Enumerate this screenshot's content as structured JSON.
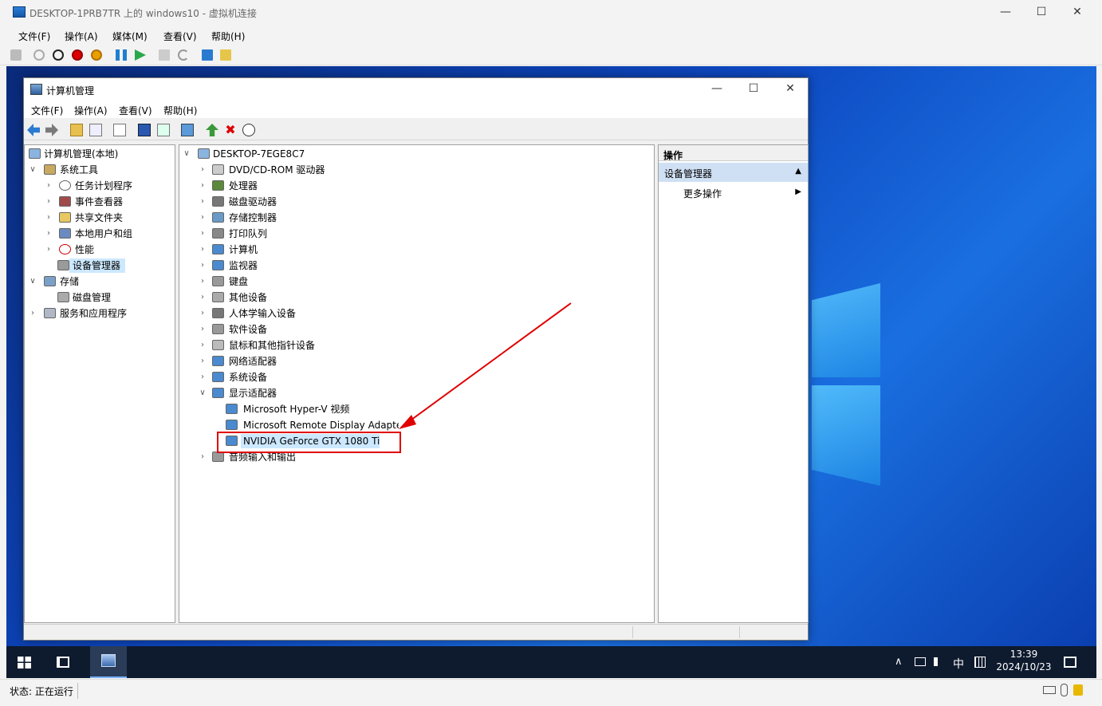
{
  "outer_window": {
    "title": "DESKTOP-1PRB7TR 上的 windows10 - 虚拟机连接",
    "menu": [
      "文件(F)",
      "操作(A)",
      "媒体(M)",
      "查看(V)",
      "帮助(H)"
    ],
    "min_glyph": "—",
    "max_glyph": "☐",
    "close_glyph": "✕"
  },
  "cm_window": {
    "title": "计算机管理",
    "menu": [
      "文件(F)",
      "操作(A)",
      "查看(V)",
      "帮助(H)"
    ],
    "min_glyph": "—",
    "max_glyph": "☐",
    "close_glyph": "✕"
  },
  "left_tree": [
    {
      "label": "计算机管理(本地)",
      "chev": ""
    },
    {
      "label": "系统工具",
      "chev": "∨"
    },
    {
      "label": "任务计划程序",
      "chev": "›"
    },
    {
      "label": "事件查看器",
      "chev": "›"
    },
    {
      "label": "共享文件夹",
      "chev": "›"
    },
    {
      "label": "本地用户和组",
      "chev": "›"
    },
    {
      "label": "性能",
      "chev": "›"
    },
    {
      "label": "设备管理器",
      "chev": ""
    },
    {
      "label": "存储",
      "chev": "∨"
    },
    {
      "label": "磁盘管理",
      "chev": ""
    },
    {
      "label": "服务和应用程序",
      "chev": "›"
    }
  ],
  "device_tree": {
    "root": "DESKTOP-7EGE8C7",
    "root_chev": "∨",
    "categories": [
      "DVD/CD-ROM 驱动器",
      "处理器",
      "磁盘驱动器",
      "存储控制器",
      "打印队列",
      "计算机",
      "监视器",
      "键盘",
      "其他设备",
      "人体学输入设备",
      "软件设备",
      "鼠标和其他指针设备",
      "网络适配器",
      "系统设备",
      "显示适配器"
    ],
    "display_adapters": [
      "Microsoft Hyper-V 视频",
      "Microsoft Remote Display Adapter",
      "NVIDIA GeForce GTX 1080 Ti"
    ],
    "last_category": "音频输入和输出",
    "collapsed_chev": "›",
    "expanded_chev": "∨"
  },
  "actions_pane": {
    "header": "操作",
    "section": "设备管理器",
    "section_glyph": "▲",
    "more": "更多操作",
    "more_glyph": "▶"
  },
  "taskbar": {
    "time": "13:39",
    "date": "2024/10/23",
    "ime": "中",
    "chevron": "∧"
  },
  "status": {
    "label": "状态: 正在运行"
  },
  "highlight_color": "#e00000"
}
